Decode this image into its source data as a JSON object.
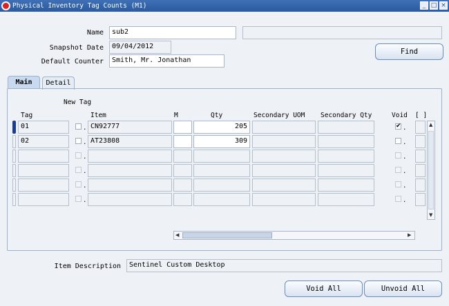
{
  "window": {
    "title": "Physical Inventory Tag Counts (M1)",
    "controls": [
      "_",
      "□",
      "×"
    ]
  },
  "header": {
    "name_label": "Name",
    "name_value": "sub2",
    "snapshot_label": "Snapshot Date",
    "snapshot_value": "09/04/2012",
    "counter_label": "Default Counter",
    "counter_value": "Smith, Mr. Jonathan",
    "find_label": "Find"
  },
  "tabs": [
    {
      "label": "Main"
    },
    {
      "label": "Detail"
    }
  ],
  "grid": {
    "new_tag_label": "New Tag",
    "columns": {
      "tag": "Tag",
      "item": "Item",
      "m": "M",
      "qty": "Qty",
      "sec_uom": "Secondary UOM",
      "sec_qty": "Secondary Qty",
      "void": "Void",
      "flex": "[ ]"
    },
    "rows": [
      {
        "tag": "01",
        "item": "CN92777",
        "qty": "205",
        "void": "✔"
      },
      {
        "tag": "02",
        "item": "AT23808",
        "qty": "309",
        "void": ""
      },
      {
        "tag": "",
        "item": "",
        "qty": "",
        "void": ""
      },
      {
        "tag": "",
        "item": "",
        "qty": "",
        "void": ""
      },
      {
        "tag": "",
        "item": "",
        "qty": "",
        "void": ""
      },
      {
        "tag": "",
        "item": "",
        "qty": "",
        "void": ""
      }
    ]
  },
  "footer": {
    "desc_label": "Item Description",
    "desc_value": "Sentinel Custom Desktop",
    "void_all_label": "Void All",
    "unvoid_all_label": "Unvoid All"
  }
}
